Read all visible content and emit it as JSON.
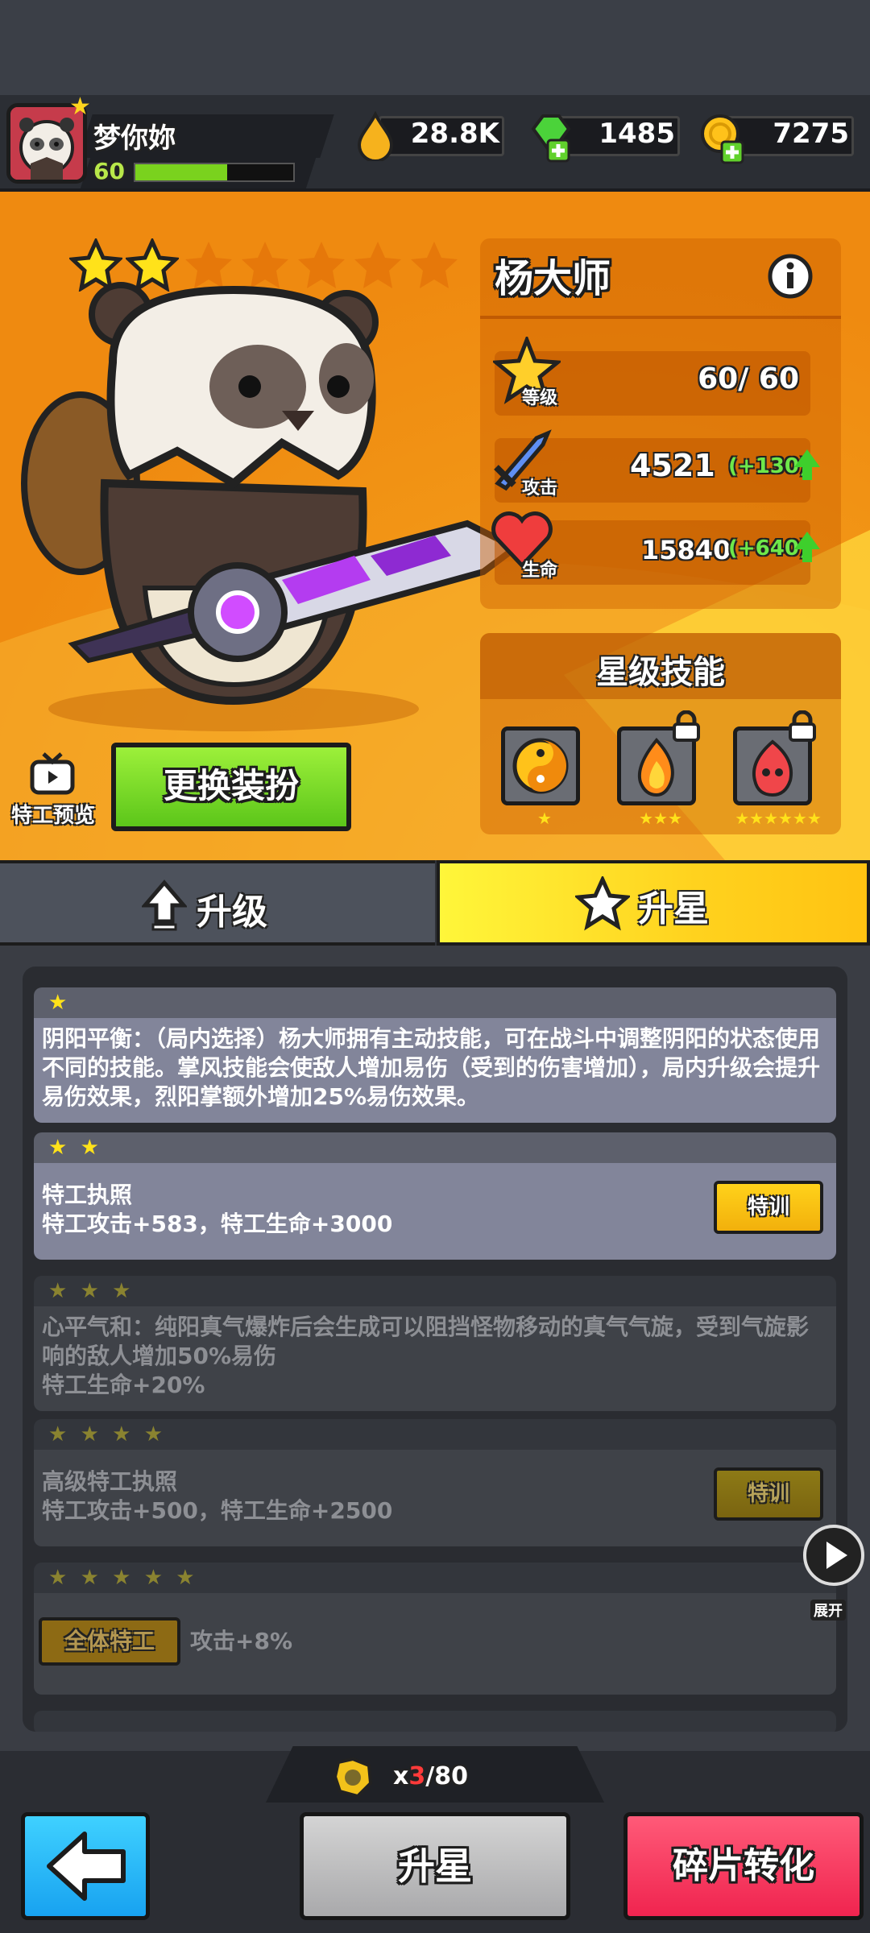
{
  "header": {
    "player_name": "梦你妳",
    "player_level": "60",
    "level_progress": 0.58,
    "resources": [
      {
        "icon": "energy-drop-icon",
        "value": "28.8K"
      },
      {
        "icon": "gem-icon",
        "value": "1485"
      },
      {
        "icon": "coin-icon",
        "value": "7275"
      }
    ]
  },
  "hero": {
    "stars_filled": 2,
    "stars_total": 7,
    "name": "杨大师",
    "stats": {
      "level_label": "等级",
      "level_value": "60/ 60",
      "attack_label": "攻击",
      "attack_value": "4521",
      "attack_bonus": "(+130)",
      "hp_label": "生命",
      "hp_value": "15840",
      "hp_bonus": "(+640)"
    },
    "skills_title": "星级技能",
    "skills": [
      {
        "icon": "yin-yang-icon",
        "stars": "★",
        "locked": false
      },
      {
        "icon": "flame-spirit-icon",
        "stars": "★★★",
        "locked": true
      },
      {
        "icon": "fire-demon-icon",
        "stars": "★★★★★★",
        "locked": true
      }
    ],
    "preview_label": "特工预览",
    "change_outfit_label": "更换装扮"
  },
  "tabs": {
    "upgrade_label": "升级",
    "star_label": "升星"
  },
  "star_list": [
    {
      "stars": "★",
      "text": "阴阳平衡：（局内选择）杨大师拥有主动技能，可在战斗中调整阴阳的状态使用不同的技能。掌风技能会使敌人增加易伤（受到的伤害增加），局内升级会提升易伤效果，烈阳掌额外增加25%易伤效果。",
      "locked": false
    },
    {
      "stars": "★ ★",
      "title": "特工执照",
      "text": "特工攻击+583，特工生命+3000",
      "button": "特训",
      "locked": false
    },
    {
      "stars": "★ ★ ★",
      "text": "心平气和：纯阳真气爆炸后会生成可以阻挡怪物移动的真气气旋，受到气旋影响的敌人增加50%易伤",
      "extra": "特工生命+20%",
      "locked": true
    },
    {
      "stars": "★ ★ ★ ★",
      "title": "高级特工执照",
      "text": "特工攻击+500，特工生命+2500",
      "button": "特训",
      "locked": true
    },
    {
      "stars": "★ ★ ★ ★ ★",
      "tag": "全体特工",
      "text": "攻击+8%",
      "locked": true
    }
  ],
  "side": {
    "expand_label": "展开"
  },
  "footer": {
    "shard_count": "x",
    "shard_current": "3",
    "shard_total": "/80",
    "back_icon": "back-arrow-icon",
    "star_up_label": "升星",
    "convert_label": "碎片转化"
  }
}
